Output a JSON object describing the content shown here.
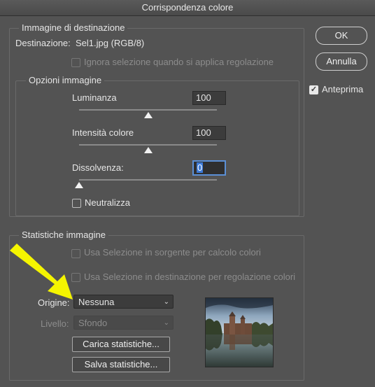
{
  "window": {
    "title": "Corrispondenza colore"
  },
  "destinazione_group": {
    "legend": "Immagine di destinazione",
    "dest_label": "Destinazione:",
    "dest_value": "Sel1.jpg (RGB/8)",
    "ignore_selection_label": "Ignora selezione quando si applica regolazione"
  },
  "opzioni_group": {
    "legend": "Opzioni immagine",
    "luminanza": {
      "label": "Luminanza",
      "value": "100",
      "level": 0.5
    },
    "intensita": {
      "label": "Intensità colore",
      "value": "100",
      "level": 0.5
    },
    "dissolvenza": {
      "label": "Dissolvenza:",
      "value": "0",
      "level": 0.0
    },
    "neutralizza_label": "Neutralizza"
  },
  "buttons": {
    "ok": "OK",
    "annulla": "Annulla"
  },
  "anteprima": {
    "label": "Anteprima",
    "checked": true
  },
  "statistiche_group": {
    "legend": "Statistiche immagine",
    "usa_sorgente_label": "Usa Selezione in sorgente per calcolo colori",
    "usa_destinazione_label": "Usa Selezione in destinazione per regolazione colori",
    "origine_label": "Origine:",
    "origine_value": "Nessuna",
    "livello_label": "Livello:",
    "livello_value": "Sfondo",
    "carica_button": "Carica statistiche...",
    "salva_button": "Salva statistiche..."
  },
  "annotation": {
    "arrow_color": "#f5f500"
  },
  "colors": {
    "background": "#535353",
    "focus": "#5b8fd6"
  }
}
